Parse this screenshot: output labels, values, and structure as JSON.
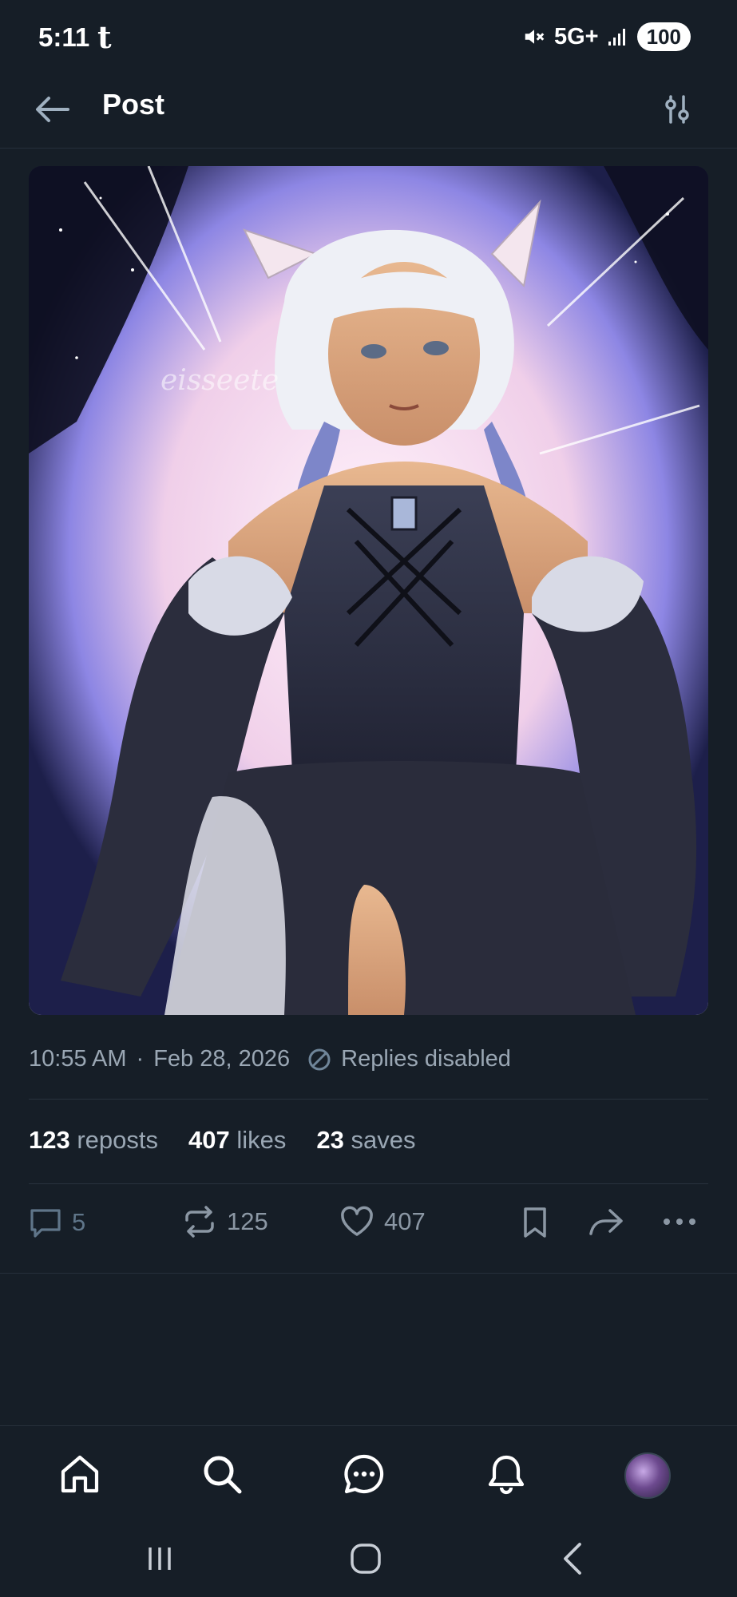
{
  "status_bar": {
    "time": "5:11",
    "app_glyph": "t",
    "network": "5G+",
    "battery": "100"
  },
  "header": {
    "title": "Post",
    "back_icon": "arrow-left-icon",
    "filter_icon": "sliders-icon"
  },
  "post": {
    "image_watermark": "eisseete",
    "time": "10:55 AM",
    "date": "Feb 28, 2026",
    "separator": "·",
    "replies_status": "Replies disabled",
    "stats": {
      "reposts_count": "123",
      "reposts_label": "reposts",
      "likes_count": "407",
      "likes_label": "likes",
      "saves_count": "23",
      "saves_label": "saves"
    },
    "actions": {
      "replies": "5",
      "reposts": "125",
      "likes": "407"
    }
  },
  "bottom_nav": [
    "home-icon",
    "search-icon",
    "chat-icon",
    "bell-icon",
    "avatar"
  ],
  "colors": {
    "background": "#161e27",
    "muted_text": "#9aa7b4",
    "icon": "#8b97a4"
  }
}
